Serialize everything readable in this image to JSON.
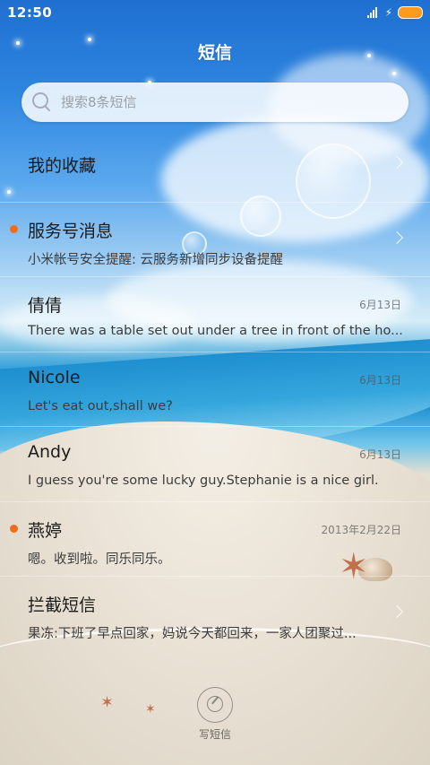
{
  "status_bar": {
    "time": "12:50"
  },
  "header": {
    "title": "短信"
  },
  "search": {
    "placeholder": "搜索8条短信"
  },
  "conversations": [
    {
      "name": "我的收藏",
      "preview": "",
      "date": "",
      "unread": false,
      "chevron": true
    },
    {
      "name": "服务号消息",
      "preview": "小米帐号安全提醒: 云服务新增同步设备提醒",
      "date": "",
      "unread": true,
      "chevron": true
    },
    {
      "name": "倩倩",
      "preview": "There was a table set out under a tree in front of the ho...",
      "date": "6月13日",
      "unread": false,
      "chevron": false
    },
    {
      "name": "Nicole",
      "preview": "Let's eat out,shall we?",
      "date": "6月13日",
      "unread": false,
      "chevron": false
    },
    {
      "name": "Andy",
      "preview": "I guess you're some lucky guy.Stephanie is a nice girl.",
      "date": "6月13日",
      "unread": false,
      "chevron": false
    },
    {
      "name": "燕婷",
      "preview": "嗯。收到啦。同乐同乐。",
      "date": "2013年2月22日",
      "unread": true,
      "chevron": false
    },
    {
      "name": "拦截短信",
      "preview": "果冻:下班了早点回家，妈说今天都回来，一家人团聚过...",
      "date": "",
      "unread": false,
      "chevron": true
    }
  ],
  "compose": {
    "label": "写短信"
  },
  "colors": {
    "unread_dot": "#f26a1b",
    "battery": "#ff9a1f"
  }
}
